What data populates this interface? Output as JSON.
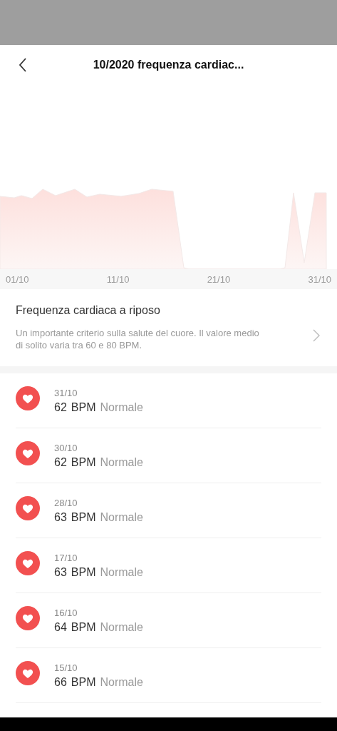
{
  "header": {
    "title": "10/2020 frequenza cardiac..."
  },
  "chart": {
    "kind": "picture",
    "x_labels": [
      "01/10",
      "11/10",
      "21/10",
      "31/10"
    ]
  },
  "info": {
    "title": "Frequenza cardiaca a riposo",
    "description": "Un importante criterio sulla salute del cuore. Il valore medio di solito varia tra 60 e 80 BPM."
  },
  "records": [
    {
      "date": "31/10",
      "value": "62",
      "unit": "BPM",
      "status": "Normale"
    },
    {
      "date": "30/10",
      "value": "62",
      "unit": "BPM",
      "status": "Normale"
    },
    {
      "date": "28/10",
      "value": "63",
      "unit": "BPM",
      "status": "Normale"
    },
    {
      "date": "17/10",
      "value": "63",
      "unit": "BPM",
      "status": "Normale"
    },
    {
      "date": "16/10",
      "value": "64",
      "unit": "BPM",
      "status": "Normale"
    },
    {
      "date": "15/10",
      "value": "66",
      "unit": "BPM",
      "status": "Normale"
    }
  ]
}
